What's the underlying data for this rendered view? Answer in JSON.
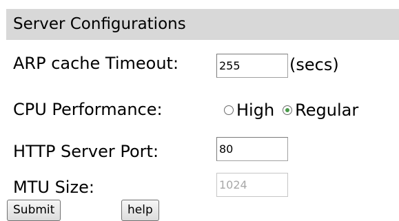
{
  "section": {
    "title": "Server Configurations"
  },
  "arp": {
    "label": "ARP cache Timeout:",
    "value": "255",
    "unit": "(secs)"
  },
  "cpu": {
    "label": "CPU Performance:",
    "options": [
      {
        "label": "High",
        "selected": false
      },
      {
        "label": "Regular",
        "selected": true
      }
    ]
  },
  "http": {
    "label": "HTTP Server Port:",
    "value": "80"
  },
  "mtu": {
    "label": "MTU Size:",
    "value": "1024",
    "disabled": true
  },
  "buttons": {
    "submit": "Submit",
    "help": "help"
  },
  "colors": {
    "header_bg": "#d8d8d8",
    "radio_selected": "#4a9a4a",
    "disabled_text": "#a8a8a8"
  }
}
